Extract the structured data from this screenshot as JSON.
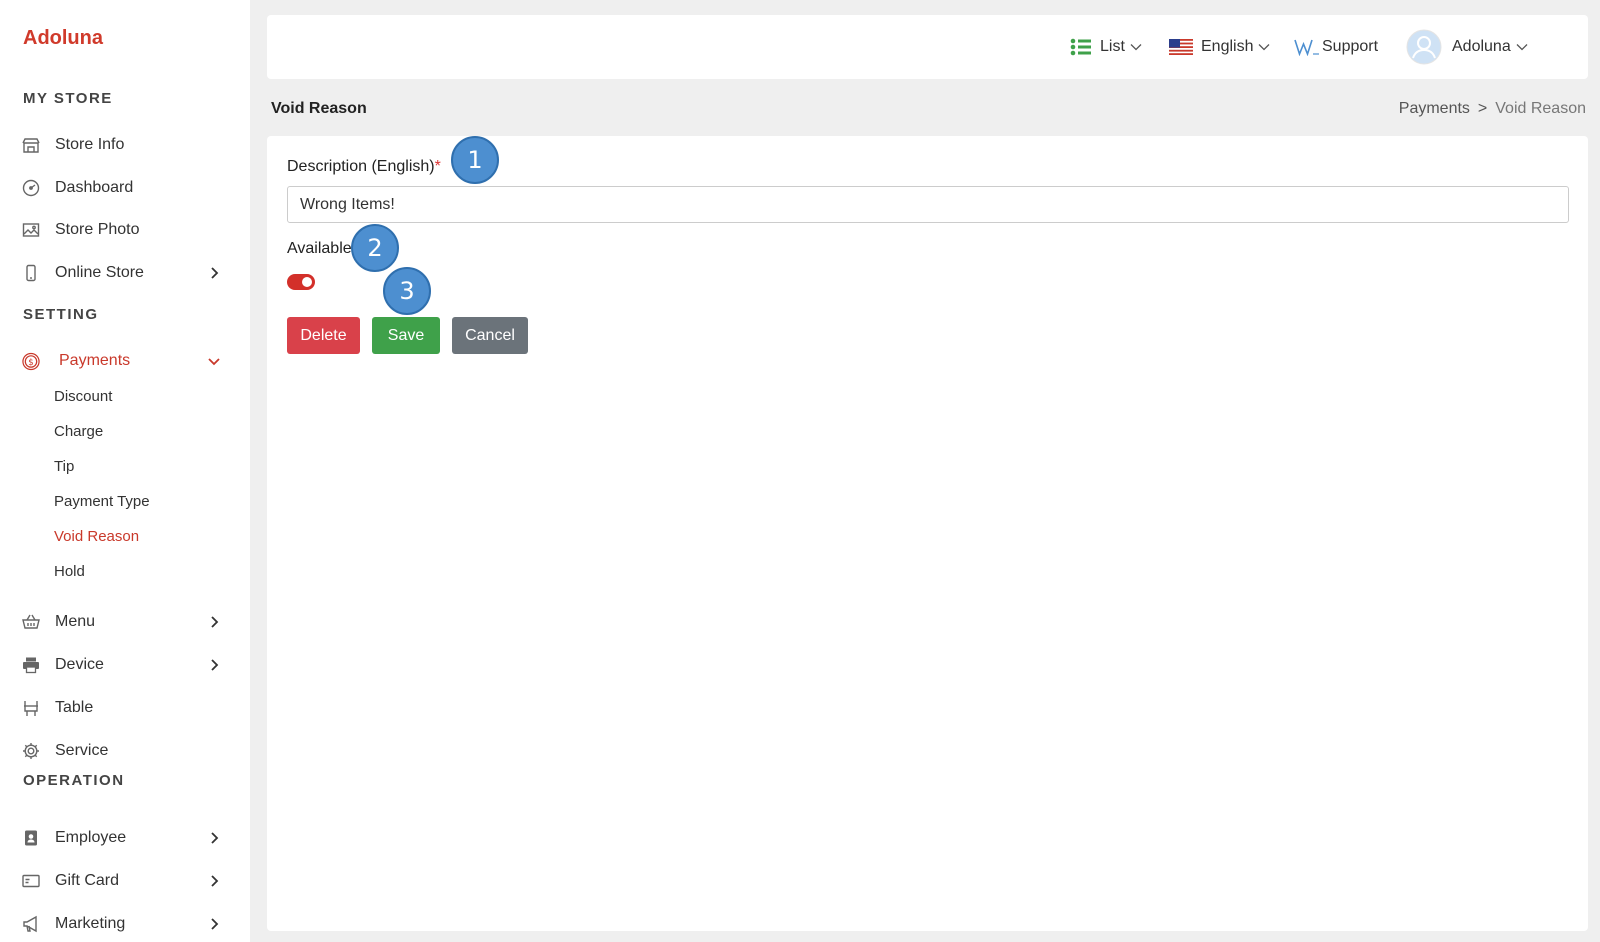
{
  "brand": "Adoluna",
  "sidebar": {
    "sections": {
      "my_store": "MY STORE",
      "setting": "SETTING",
      "operation": "OPERATION"
    },
    "items": {
      "store_info": "Store Info",
      "dashboard": "Dashboard",
      "store_photo": "Store Photo",
      "online_store": "Online Store",
      "payments": "Payments",
      "menu": "Menu",
      "device": "Device",
      "table": "Table",
      "service": "Service",
      "employee": "Employee",
      "gift_card": "Gift Card",
      "marketing": "Marketing"
    },
    "payments_sub": [
      "Discount",
      "Charge",
      "Tip",
      "Payment Type",
      "Void Reason",
      "Hold"
    ],
    "active_sub": "Void Reason"
  },
  "topbar": {
    "list_label": "List",
    "language_label": "English",
    "support_label": "Support",
    "user_label": "Adoluna"
  },
  "page": {
    "title": "Void Reason",
    "breadcrumb": [
      "Payments",
      ">",
      "Void Reason"
    ]
  },
  "form": {
    "description_label": "Description (English)",
    "required_mark": "*",
    "description_value": "Wrong Items!",
    "available_label": "Available",
    "available_on": true,
    "delete_label": "Delete",
    "save_label": "Save",
    "cancel_label": "Cancel"
  },
  "steps": [
    "1",
    "2",
    "3"
  ],
  "colors": {
    "accent": "#c9392b",
    "delete": "#d9414a",
    "save": "#3fa14a",
    "cancel": "#6b737a",
    "step_badge": "#4d8fd0"
  }
}
